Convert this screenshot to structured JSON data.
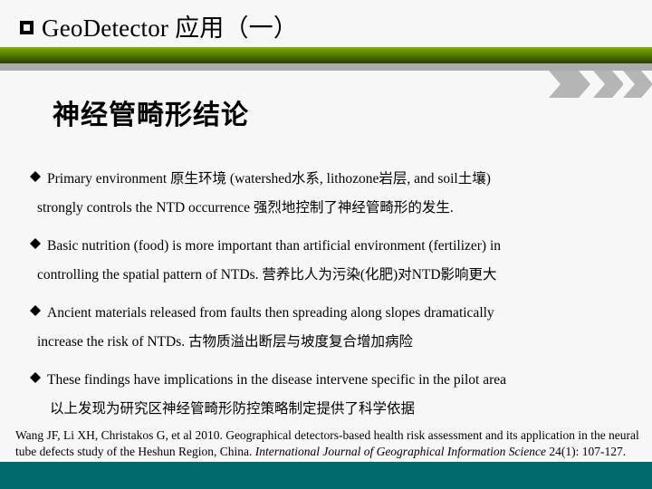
{
  "slide": {
    "title_marker": "square-bullet",
    "title": "GeoDetector 应用（一）",
    "subtitle": "神经管畸形结论"
  },
  "colors": {
    "background": "#f7f7f7",
    "accent_green_light": "#8bb400",
    "accent_green_dark": "#2b4300",
    "gray_rule": "#ababab",
    "chevron_gray": "#b5b5b5",
    "footer_teal": "#00696b",
    "text": "#000000"
  },
  "bullets": [
    {
      "marker": "diamond",
      "line1": "Primary environment 原生环境 (watershed水系, lithozone岩层, and soil土壤)",
      "line2": "strongly controls the NTD occurrence 强烈地控制了神经管畸形的发生."
    },
    {
      "marker": "diamond",
      "line1": "Basic nutrition (food) is more important than artificial environment (fertilizer) in",
      "line2": "controlling the spatial pattern of NTDs. 营养比人为污染(化肥)对NTD影响更大"
    },
    {
      "marker": "diamond",
      "line1": "Ancient materials released from faults then spreading along slopes dramatically",
      "line2": "increase the risk of NTDs. 古物质溢出断层与坡度复合增加病险"
    },
    {
      "marker": "diamond",
      "line1": "These findings have implications in the disease intervene specific in the pilot area",
      "line2": "以上发现为研究区神经管畸形防控策略制定提供了科学依据"
    }
  ],
  "citation": {
    "part1": "Wang JF, Li XH, Christakos G, et al 2010. Geographical detectors-based health risk assessment and its application in the neural tube  defects study of the Heshun Region, China. ",
    "journal": "International Journal of Geographical Information Science",
    "part2": " 24(1): 107-127."
  }
}
